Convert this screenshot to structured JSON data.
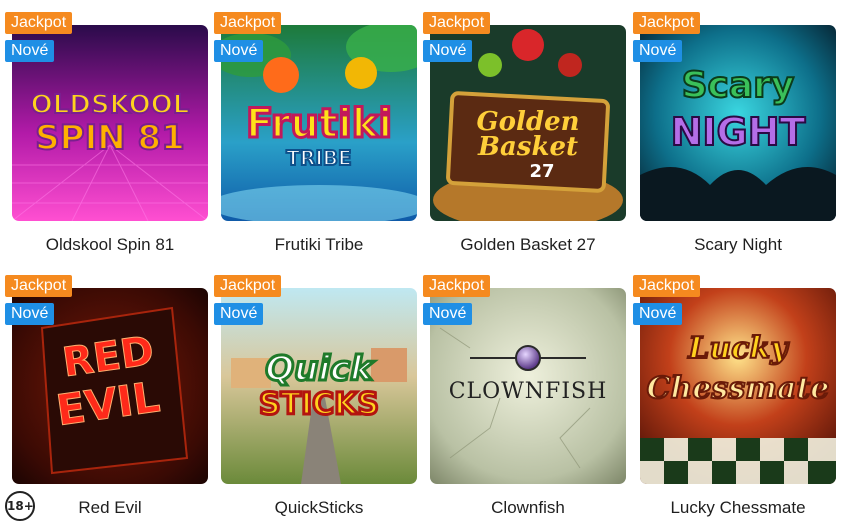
{
  "badges": {
    "jackpot": "Jackpot",
    "new": "Nové"
  },
  "games": [
    {
      "title": "Oldskool Spin 81",
      "logo": [
        "OLDSKOOL",
        "SPIN 81"
      ]
    },
    {
      "title": "Frutiki Tribe",
      "logo": [
        "Frutiki",
        "TRIBE"
      ]
    },
    {
      "title": "Golden Basket 27",
      "logo": [
        "Golden",
        "Basket",
        "27"
      ]
    },
    {
      "title": "Scary Night",
      "logo": [
        "Scary",
        "NIGHT"
      ]
    },
    {
      "title": "Red Evil",
      "logo": [
        "RED",
        "EVIL"
      ]
    },
    {
      "title": "QuickSticks",
      "logo": [
        "Quick",
        "STICKS"
      ]
    },
    {
      "title": "Clownfish",
      "logo": [
        "CLOWNFISH"
      ]
    },
    {
      "title": "Lucky Chessmate",
      "logo": [
        "Lucky",
        "Chessmate"
      ]
    }
  ],
  "age_badge": "18+",
  "colors": {
    "jackpot": "#f58a1f",
    "new": "#1f8fe5"
  }
}
